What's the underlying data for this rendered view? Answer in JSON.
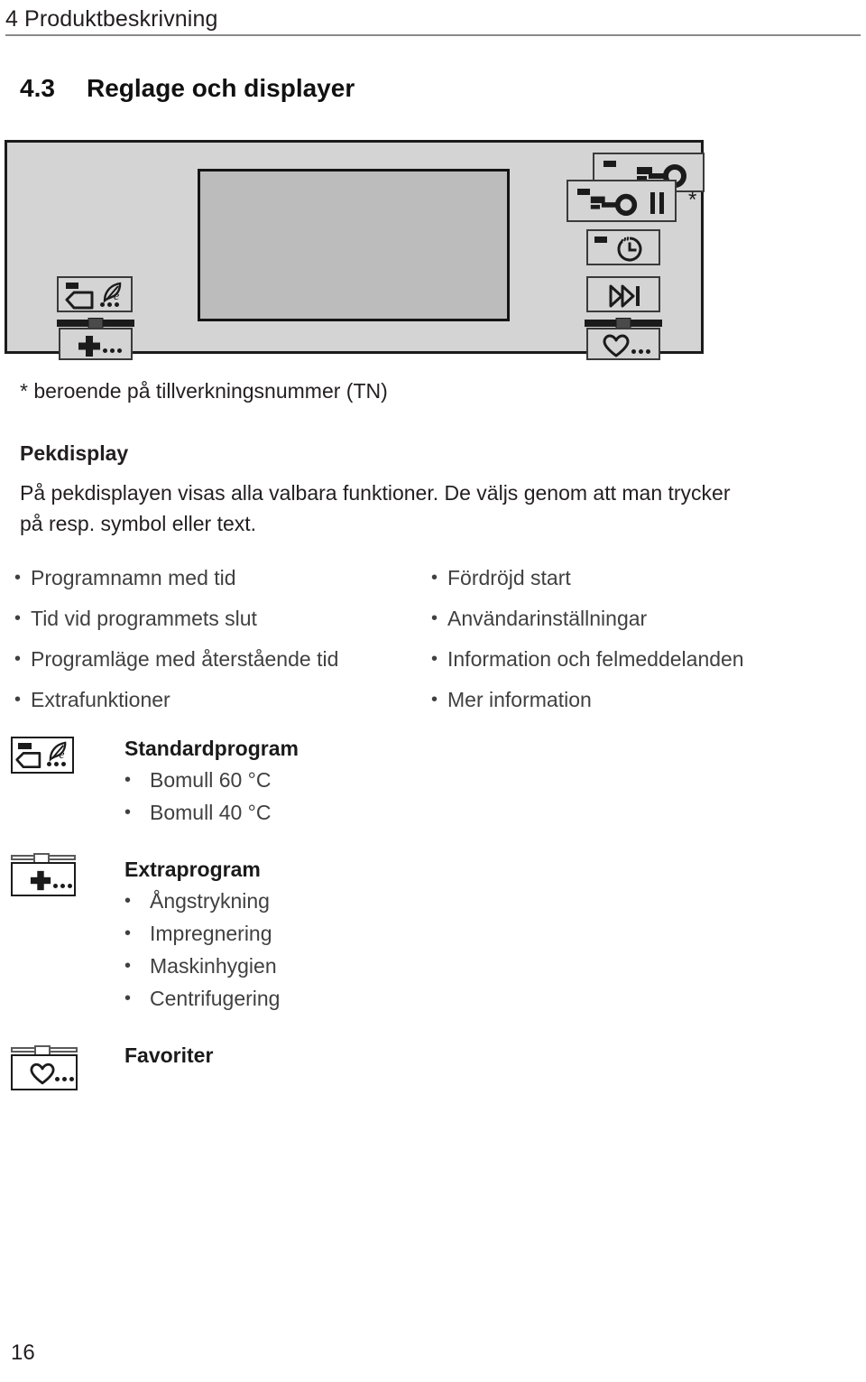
{
  "header": {
    "chapter": "4 Produktbeskrivning"
  },
  "section": {
    "number": "4.3",
    "title": "Reglage och displayer"
  },
  "control_panel": {
    "display_label": "touch-display",
    "buttons": [
      {
        "name": "door-lock-button",
        "icon": "key-icon",
        "variant": "tn-variant-upper"
      },
      {
        "name": "door-lock-pause-button",
        "icon": "key-pause-icon",
        "variant": "tn-variant-lower"
      },
      {
        "name": "delayed-start-button",
        "icon": "clock-icon"
      },
      {
        "name": "skip-button",
        "icon": "fast-forward-icon"
      },
      {
        "name": "favourites-button",
        "icon": "heart-icon"
      },
      {
        "name": "programme-selector-button",
        "icon": "textile-feather-icon"
      },
      {
        "name": "extras-button",
        "icon": "plus-icon"
      }
    ],
    "asterisk": "*"
  },
  "footnote": "* beroende på tillverkningsnummer (TN)",
  "touch_display": {
    "heading": "Pekdisplay",
    "paragraph_line1": "På pekdisplayen visas alla valbara funktioner. De väljs genom att man trycker",
    "paragraph_line2": "på resp. symbol eller text."
  },
  "features": {
    "bullet": "•",
    "left_column": [
      "Programnamn med tid",
      "Tid vid programmets slut",
      "Programläge med återstående tid",
      "Extrafunktioner"
    ],
    "right_column": [
      "Fördröjd start",
      "Användarinställningar",
      "Information och felmeddelanden",
      "Mer information"
    ]
  },
  "programme_groups": [
    {
      "icon": "textile-feather-icon",
      "title": "Standardprogram",
      "bullet": "•",
      "items": [
        "Bomull 60 °C",
        "Bomull 40 °C"
      ]
    },
    {
      "icon": "plus-icon",
      "title": "Extraprogram",
      "bullet": "•",
      "items": [
        "Ångstrykning",
        "Impregnering",
        "Maskinhygien",
        "Centrifugering"
      ]
    },
    {
      "icon": "heart-icon",
      "title": "Favoriter",
      "bullet": "•",
      "items": []
    }
  ],
  "page_number": "16",
  "colors": {
    "panel_face": "#d4d4d4",
    "display_face": "#bcbcbc",
    "ink": "#1b1b1b",
    "rule": "#8a8a8a"
  }
}
